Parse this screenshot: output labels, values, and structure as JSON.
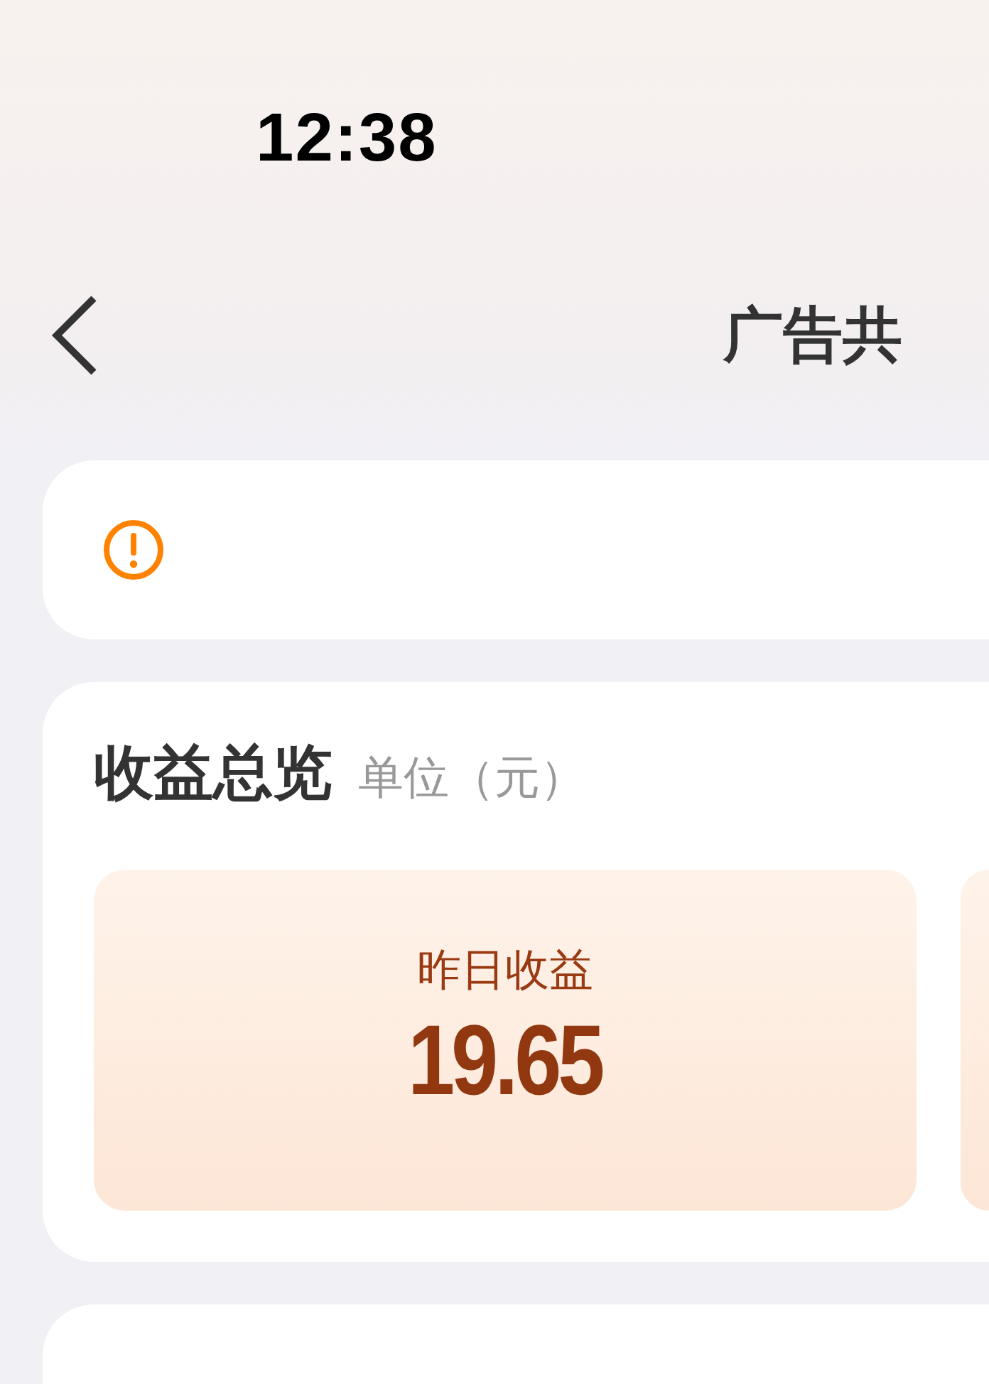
{
  "status_bar": {
    "time": "12:38"
  },
  "nav": {
    "title": "广告共"
  },
  "overview": {
    "title": "收益总览",
    "unit": "单位（元）",
    "tiles": [
      {
        "label": "昨日收益",
        "value": "19.65"
      }
    ]
  }
}
